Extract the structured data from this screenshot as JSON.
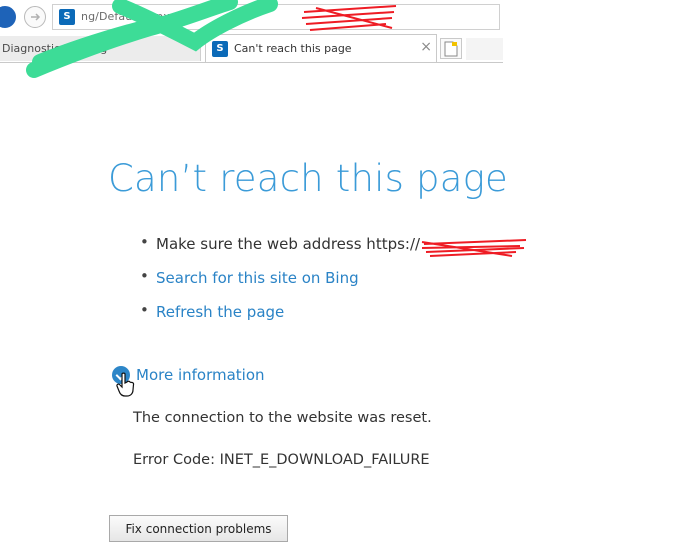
{
  "browser": {
    "address_url": "ng/Default.aspx",
    "sp_icon_text": "S",
    "tabs": [
      {
        "label": "Diagnostic Logging",
        "active": false
      },
      {
        "label": "Can't reach this page",
        "active": true
      }
    ],
    "close_glyph": "×"
  },
  "page": {
    "heading": "Can’t reach this page",
    "bullets": [
      {
        "text": "Make sure the web address https://",
        "link": false
      },
      {
        "text": "Search for this site on Bing",
        "link": true
      },
      {
        "text": "Refresh the page",
        "link": true
      }
    ],
    "more_info_label": "More information",
    "connection_message": "The connection to the website was reset.",
    "error_code": "Error Code: INET_E_DOWNLOAD_FAILURE",
    "fix_button_label": "Fix connection problems"
  },
  "colors": {
    "heading": "#3b9bd8",
    "link": "#2a83c6",
    "redaction_green": "#3ddc97",
    "redaction_red": "#ee1c24"
  },
  "icons": [
    "back-arrow-icon",
    "forward-arrow-icon",
    "sharepoint-icon",
    "new-tab-icon",
    "expand-chevron-icon",
    "hand-cursor-icon"
  ]
}
